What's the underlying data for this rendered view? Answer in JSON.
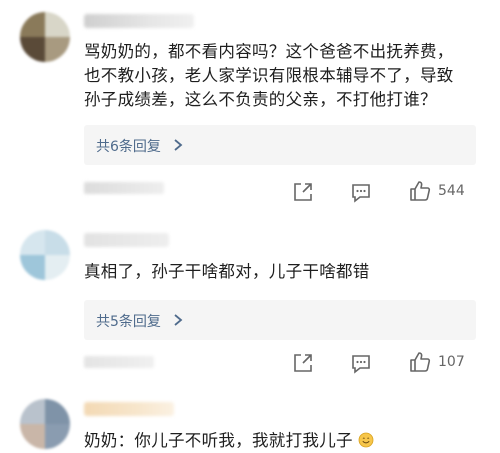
{
  "comments": [
    {
      "text_lines": [
        "骂奶奶的，都不看内容吗？这个爸爸不出抚养费，",
        "也不教小孩，老人家学识有限根本辅导不了，导致",
        "孙子成绩差，这么不负责的父亲，不打他打谁？"
      ],
      "replies_label": "共6条回复",
      "like_count": "544"
    },
    {
      "text_lines": [
        "真相了，孙子干啥都对，儿子干啥都错"
      ],
      "replies_label": "共5条回复",
      "like_count": "107"
    },
    {
      "text_lines": [
        "奶奶：你儿子不听我，我就打我儿子"
      ],
      "emoji": "smile-emoji"
    }
  ],
  "icons": {
    "share": "share-icon",
    "comment": "comment-icon",
    "like": "thumbs-up-icon",
    "chevron": "chevron-right-icon"
  },
  "colors": {
    "reply_link": "#4f6b8c",
    "reply_bg": "#f5f5f5",
    "text": "#1e1e1e",
    "meta": "#666666"
  }
}
